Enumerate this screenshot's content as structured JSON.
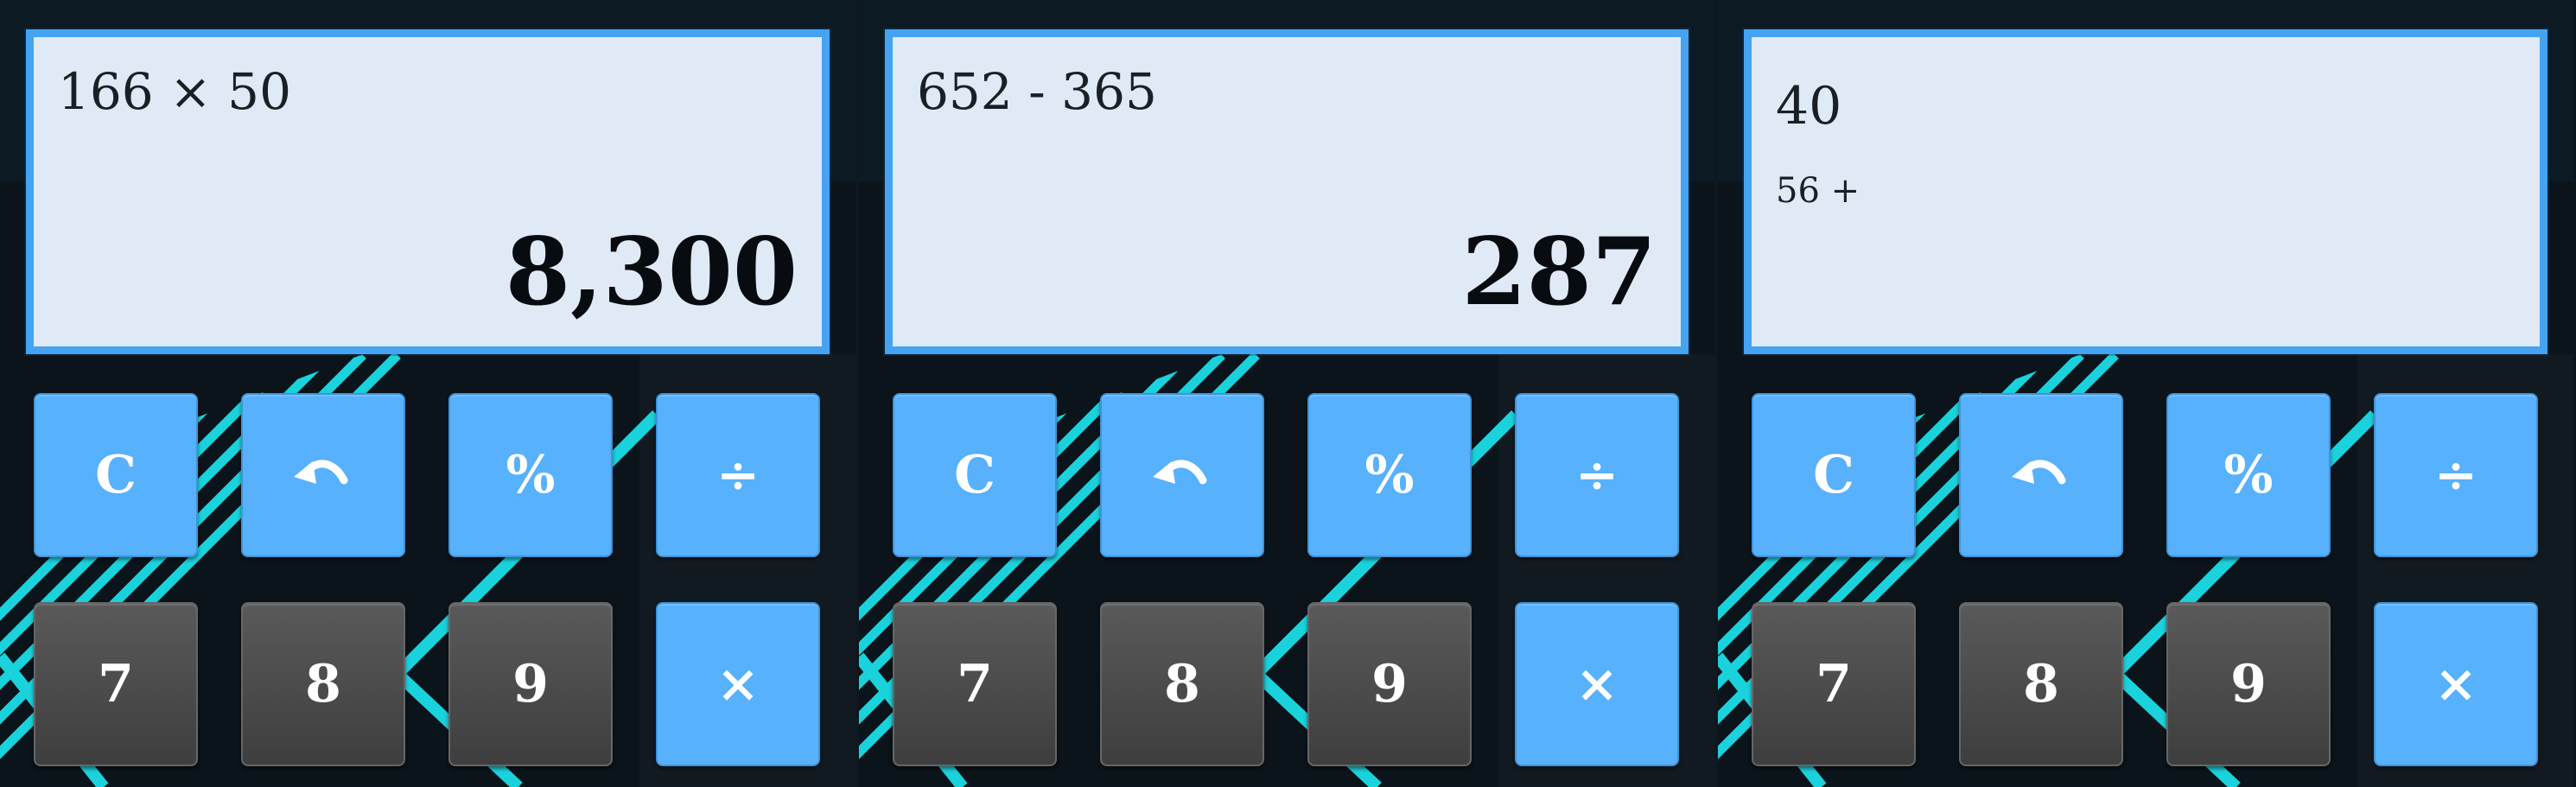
{
  "colors": {
    "page_background": "#0b141b",
    "display_background": "#dfeaf6",
    "display_border": "#45a3f2",
    "operator_button": "#57b1fd",
    "digit_button": "#4a4a4a",
    "stripe_accent": "#19d2dc"
  },
  "panels": [
    {
      "expression": "166 × 50",
      "subexpression": "",
      "result": "8,300",
      "buttons": [
        {
          "label": "C",
          "kind": "operator",
          "icon": "clear-text"
        },
        {
          "label": "",
          "kind": "operator",
          "icon": "undo-icon"
        },
        {
          "label": "%",
          "kind": "operator",
          "icon": "percent-text"
        },
        {
          "label": "÷",
          "kind": "operator",
          "icon": "divide-text"
        },
        {
          "label": "7",
          "kind": "digit"
        },
        {
          "label": "8",
          "kind": "digit"
        },
        {
          "label": "9",
          "kind": "digit"
        },
        {
          "label": "×",
          "kind": "operator",
          "icon": "multiply-text"
        }
      ]
    },
    {
      "expression": "652 - 365",
      "subexpression": "",
      "result": "287",
      "buttons": [
        {
          "label": "C",
          "kind": "operator",
          "icon": "clear-text"
        },
        {
          "label": "",
          "kind": "operator",
          "icon": "undo-icon"
        },
        {
          "label": "%",
          "kind": "operator",
          "icon": "percent-text"
        },
        {
          "label": "÷",
          "kind": "operator",
          "icon": "divide-text"
        },
        {
          "label": "7",
          "kind": "digit"
        },
        {
          "label": "8",
          "kind": "digit"
        },
        {
          "label": "9",
          "kind": "digit"
        },
        {
          "label": "×",
          "kind": "operator",
          "icon": "multiply-text"
        }
      ]
    },
    {
      "expression": "40",
      "subexpression": "56 +",
      "result": "",
      "buttons": [
        {
          "label": "C",
          "kind": "operator",
          "icon": "clear-text"
        },
        {
          "label": "",
          "kind": "operator",
          "icon": "undo-icon"
        },
        {
          "label": "%",
          "kind": "operator",
          "icon": "percent-text"
        },
        {
          "label": "÷",
          "kind": "operator",
          "icon": "divide-text"
        },
        {
          "label": "7",
          "kind": "digit"
        },
        {
          "label": "8",
          "kind": "digit"
        },
        {
          "label": "9",
          "kind": "digit"
        },
        {
          "label": "×",
          "kind": "operator",
          "icon": "multiply-text"
        }
      ]
    }
  ]
}
